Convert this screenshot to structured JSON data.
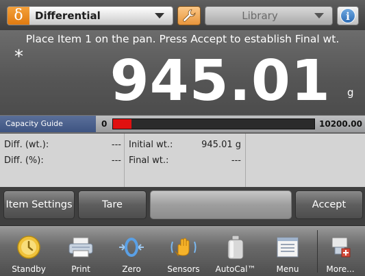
{
  "topbar": {
    "app_symbol": "δ",
    "app_name": "Differential",
    "library_label": "Library",
    "info_symbol": "i"
  },
  "reading": {
    "prompt": "Place Item 1 on the pan.  Press Accept to establish Final wt.",
    "stability_marker": "*",
    "value": "945.01",
    "unit": "g"
  },
  "capacity": {
    "label": "Capacity Guide",
    "min": "0",
    "max": "10200.00",
    "fill_fraction": 0.0927
  },
  "results": {
    "diff_wt_label": "Diff. (wt.):",
    "diff_wt_value": "---",
    "diff_pct_label": "Diff. (%):",
    "diff_pct_value": "---",
    "initial_label": "Initial wt.:",
    "initial_value": "945.01 g",
    "final_label": "Final wt.:",
    "final_value": "---"
  },
  "softkeys": {
    "item_settings": "Item Settings",
    "tare": "Tare",
    "accept": "Accept"
  },
  "nav": [
    {
      "label": "Standby",
      "icon": "standby-icon"
    },
    {
      "label": "Print",
      "icon": "printer-icon"
    },
    {
      "label": "Zero",
      "icon": "zero-icon"
    },
    {
      "label": "Sensors",
      "icon": "hand-sensor-icon"
    },
    {
      "label": "AutoCal™",
      "icon": "calibration-weight-icon"
    },
    {
      "label": "Menu",
      "icon": "menu-icon"
    },
    {
      "label": "More...",
      "icon": "more-icon"
    }
  ],
  "colors": {
    "accent_orange": "#e8953c",
    "capacity_fill": "#e01010",
    "capacity_label_bg": "#4a6090"
  }
}
